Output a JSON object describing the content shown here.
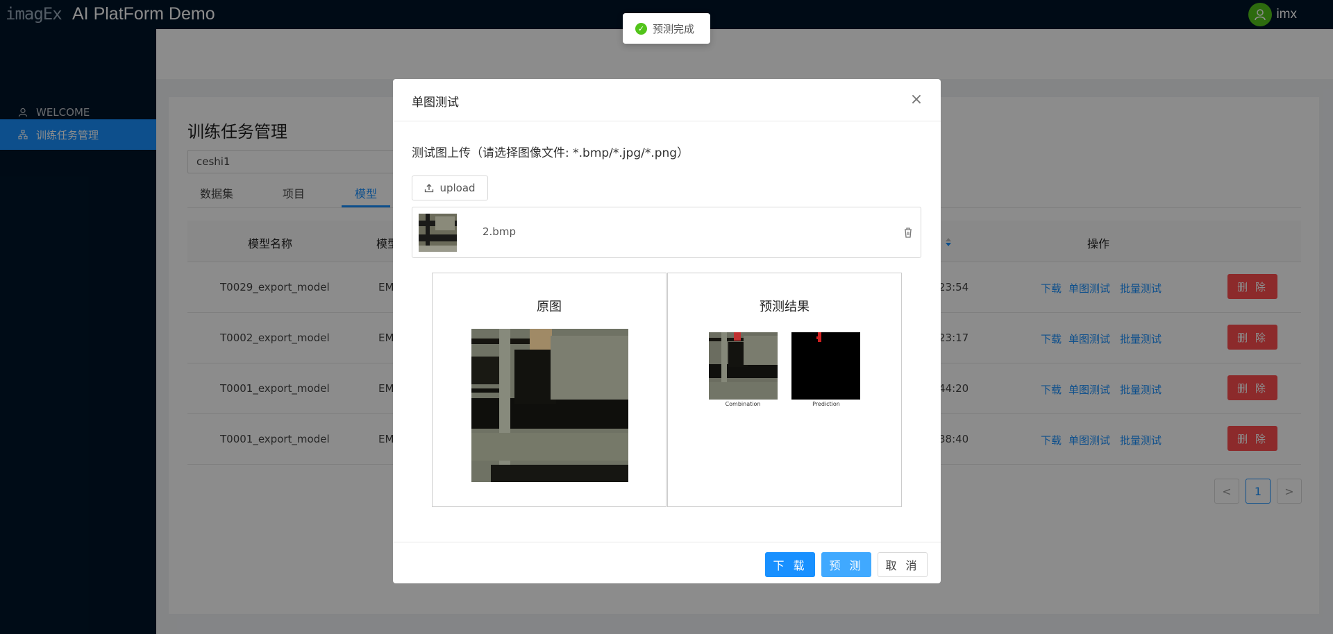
{
  "header": {
    "logo_text": "imagEx",
    "app_title": "AI PlatForm Demo",
    "username": "imx"
  },
  "sidebar": {
    "items": [
      {
        "label": "WELCOME",
        "icon": "user-icon"
      },
      {
        "label": "训练任务管理",
        "icon": "apartment-icon"
      }
    ]
  },
  "main": {
    "page_title": "训练任务管理",
    "project_value": "ceshi1",
    "tabs": [
      "数据集",
      "项目",
      "模型"
    ],
    "active_tab": "模型",
    "columns": [
      "模型名称",
      "模型",
      "操作"
    ],
    "rows": [
      {
        "name": "T0029_export_model",
        "type": "EM",
        "time": "23:54"
      },
      {
        "name": "T0002_export_model",
        "type": "EM",
        "time": "23:17"
      },
      {
        "name": "T0001_export_model",
        "type": "EM",
        "time": "44:20"
      },
      {
        "name": "T0001_export_model",
        "type": "EM",
        "time": "38:40"
      }
    ],
    "row_actions": {
      "download": "下载",
      "single_test": "单图测试",
      "batch_test": "批量测试",
      "delete": "删 除"
    },
    "pagination": {
      "prev": "<",
      "current": "1",
      "next": ">"
    }
  },
  "toast": {
    "message": "预测完成"
  },
  "modal": {
    "title": "单图测试",
    "close": "×",
    "upload_label": "测试图上传（请选择图像文件: *.bmp/*.jpg/*.png）",
    "upload_button": "upload",
    "file_name": "2.bmp",
    "original_title": "原图",
    "result_title": "预测结果",
    "result_captions": [
      "Combination",
      "Prediction"
    ],
    "buttons": {
      "download": "下 载",
      "predict": "预 测",
      "cancel": "取 消"
    }
  },
  "colors": {
    "primary": "#1890ff",
    "danger": "#ff4d4f",
    "sidebar": "#001529",
    "success": "#52c41a"
  }
}
